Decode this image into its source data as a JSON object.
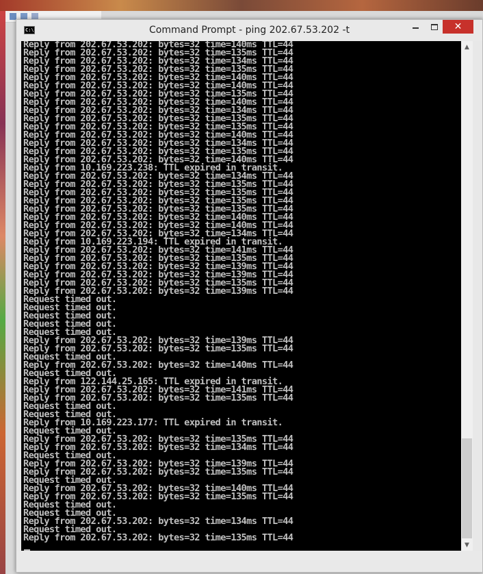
{
  "window": {
    "title": "Command Prompt - ping  202.67.53.202 -t",
    "app_icon_text": "C:\\",
    "controls": {
      "minimize": "minimize-icon",
      "maximize": "maximize-icon",
      "close": "close-icon",
      "close_glyph": "✕"
    },
    "accent_close": "#c7312b"
  },
  "console": {
    "text_color": "#c0c0c0",
    "background": "#000000",
    "lines": [
      "Reply from 202.67.53.202: bytes=32 time=140ms TTL=44",
      "Reply from 202.67.53.202: bytes=32 time=135ms TTL=44",
      "Reply from 202.67.53.202: bytes=32 time=134ms TTL=44",
      "Reply from 202.67.53.202: bytes=32 time=135ms TTL=44",
      "Reply from 202.67.53.202: bytes=32 time=140ms TTL=44",
      "Reply from 202.67.53.202: bytes=32 time=140ms TTL=44",
      "Reply from 202.67.53.202: bytes=32 time=135ms TTL=44",
      "Reply from 202.67.53.202: bytes=32 time=140ms TTL=44",
      "Reply from 202.67.53.202: bytes=32 time=134ms TTL=44",
      "Reply from 202.67.53.202: bytes=32 time=135ms TTL=44",
      "Reply from 202.67.53.202: bytes=32 time=135ms TTL=44",
      "Reply from 202.67.53.202: bytes=32 time=140ms TTL=44",
      "Reply from 202.67.53.202: bytes=32 time=134ms TTL=44",
      "Reply from 202.67.53.202: bytes=32 time=135ms TTL=44",
      "Reply from 202.67.53.202: bytes=32 time=140ms TTL=44",
      "Reply from 10.169.223.238: TTL expired in transit.",
      "Reply from 202.67.53.202: bytes=32 time=134ms TTL=44",
      "Reply from 202.67.53.202: bytes=32 time=135ms TTL=44",
      "Reply from 202.67.53.202: bytes=32 time=135ms TTL=44",
      "Reply from 202.67.53.202: bytes=32 time=135ms TTL=44",
      "Reply from 202.67.53.202: bytes=32 time=135ms TTL=44",
      "Reply from 202.67.53.202: bytes=32 time=140ms TTL=44",
      "Reply from 202.67.53.202: bytes=32 time=140ms TTL=44",
      "Reply from 202.67.53.202: bytes=32 time=134ms TTL=44",
      "Reply from 10.169.223.194: TTL expired in transit.",
      "Reply from 202.67.53.202: bytes=32 time=141ms TTL=44",
      "Reply from 202.67.53.202: bytes=32 time=135ms TTL=44",
      "Reply from 202.67.53.202: bytes=32 time=139ms TTL=44",
      "Reply from 202.67.53.202: bytes=32 time=139ms TTL=44",
      "Reply from 202.67.53.202: bytes=32 time=135ms TTL=44",
      "Reply from 202.67.53.202: bytes=32 time=139ms TTL=44",
      "Request timed out.",
      "Request timed out.",
      "Request timed out.",
      "Request timed out.",
      "Request timed out.",
      "Reply from 202.67.53.202: bytes=32 time=139ms TTL=44",
      "Reply from 202.67.53.202: bytes=32 time=135ms TTL=44",
      "Request timed out.",
      "Reply from 202.67.53.202: bytes=32 time=140ms TTL=44",
      "Request timed out.",
      "Reply from 122.144.25.165: TTL expired in transit.",
      "Reply from 202.67.53.202: bytes=32 time=141ms TTL=44",
      "Reply from 202.67.53.202: bytes=32 time=135ms TTL=44",
      "Request timed out.",
      "Request timed out.",
      "Reply from 10.169.223.177: TTL expired in transit.",
      "Request timed out.",
      "Reply from 202.67.53.202: bytes=32 time=135ms TTL=44",
      "Reply from 202.67.53.202: bytes=32 time=134ms TTL=44",
      "Request timed out.",
      "Reply from 202.67.53.202: bytes=32 time=139ms TTL=44",
      "Reply from 202.67.53.202: bytes=32 time=135ms TTL=44",
      "Request timed out.",
      "Reply from 202.67.53.202: bytes=32 time=140ms TTL=44",
      "Reply from 202.67.53.202: bytes=32 time=135ms TTL=44",
      "Request timed out.",
      "Request timed out.",
      "Reply from 202.67.53.202: bytes=32 time=134ms TTL=44",
      "Request timed out.",
      "Reply from 202.67.53.202: bytes=32 time=135ms TTL=44"
    ]
  },
  "scrollbar": {
    "up_arrow": "▲",
    "down_arrow": "▼",
    "position_fraction": 0.97
  }
}
